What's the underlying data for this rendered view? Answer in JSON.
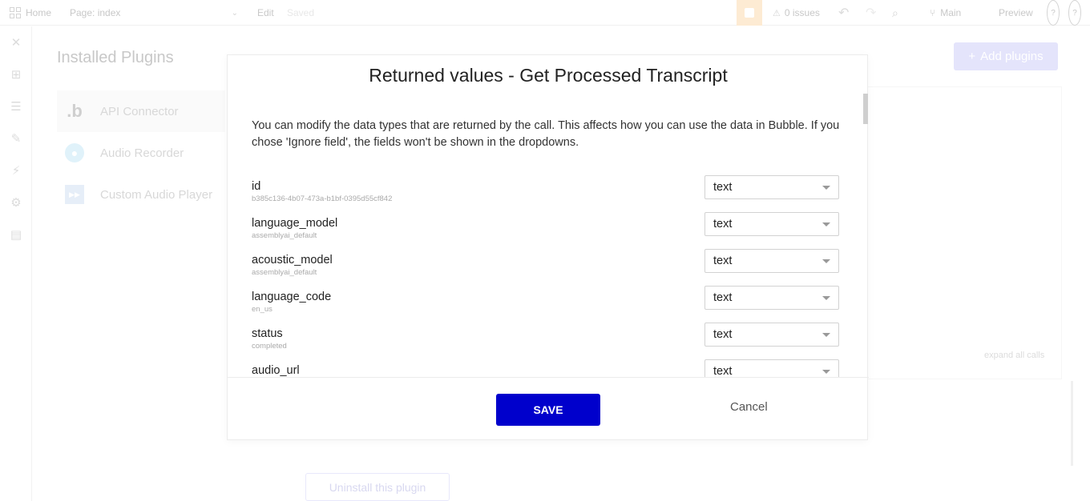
{
  "topbar": {
    "home_label": "Home",
    "page_label": "Page: index",
    "edit_label": "Edit",
    "saved_label": "Saved",
    "issues_label": "0 issues",
    "branch_label": "Main",
    "preview_label": "Preview",
    "help_label": "?"
  },
  "page": {
    "title": "Installed Plugins",
    "add_plugins_label": "Add plugins",
    "plugins": [
      {
        "label": "API Connector",
        "icon": ".b"
      },
      {
        "label": "Audio Recorder",
        "icon": "mic-icon"
      },
      {
        "label": "Custom Audio Player",
        "icon": "player-icon"
      }
    ],
    "expand_all_label": "expand all calls",
    "uninstall_label": "Uninstall this plugin"
  },
  "modal": {
    "title": "Returned values - Get Processed Transcript",
    "description": "You can modify the data types that are returned by the call. This affects how you can use the data in Bubble. If you chose 'Ignore field', the fields won't be shown in the dropdowns.",
    "fields": [
      {
        "name": "id",
        "sample": "b385c136-4b07-473a-b1bf-0395d55cf842",
        "type": "text"
      },
      {
        "name": "language_model",
        "sample": "assemblyai_default",
        "type": "text"
      },
      {
        "name": "acoustic_model",
        "sample": "assemblyai_default",
        "type": "text"
      },
      {
        "name": "language_code",
        "sample": "en_us",
        "type": "text"
      },
      {
        "name": "status",
        "sample": "completed",
        "type": "text"
      },
      {
        "name": "audio_url",
        "sample": "",
        "type": "text"
      }
    ],
    "save_label": "SAVE",
    "cancel_label": "Cancel"
  },
  "colors": {
    "primary": "#0000cc",
    "add_plugins_bg": "#e4e4fb"
  }
}
